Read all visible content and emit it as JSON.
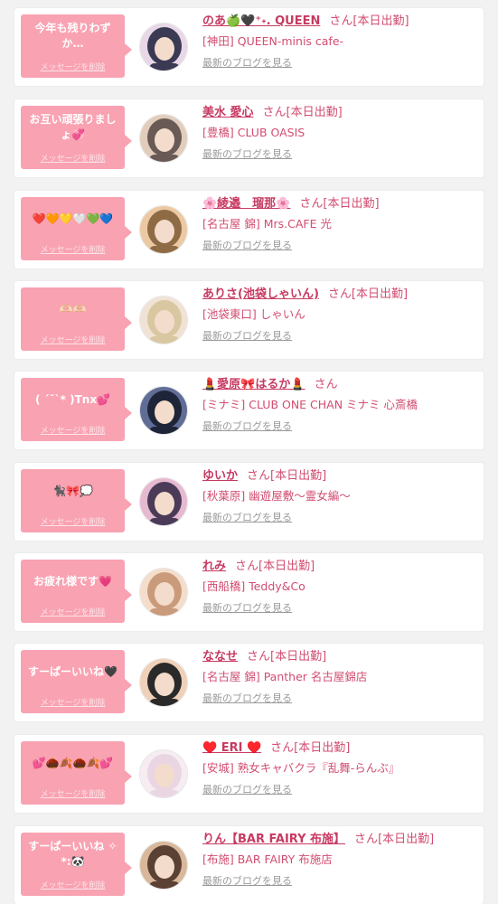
{
  "delete_label": "メッセージを削除",
  "blog_label": "最新のブログを見る",
  "honorific": "さん",
  "colors": {
    "bubble": "#f9a2b2",
    "accent": "#d24d71",
    "background": "#f2f2f2"
  },
  "messages": [
    {
      "bubble": "今年も残りわずか…",
      "name": "のあ🍏🖤⁺˖. QUEEN",
      "status": "[本日出勤]",
      "shop": "[神田] QUEEN-minis cafe-",
      "avatar_colors": [
        "#3a3a55",
        "#e8d7e6"
      ]
    },
    {
      "bubble": "お互い頑張りましょ💞",
      "name": "美水 愛心",
      "status": "[本日出勤]",
      "shop": "[豊橋] CLUB OASIS",
      "avatar_colors": [
        "#6a5a55",
        "#e2cdbd"
      ]
    },
    {
      "bubble": "❤️🧡💛🤍💚💙",
      "name": "🌸綾邉　瑠那🌸",
      "status": "[本日出勤]",
      "shop": "[名古屋 錦] Mrs.CAFE 光",
      "avatar_colors": [
        "#8f6b45",
        "#ecc9a2"
      ]
    },
    {
      "bubble": "🫶🏻🫶🏻",
      "name": "ありさ(池袋しゃいん)",
      "status": "[本日出勤]",
      "shop": "[池袋東口] しゃいん",
      "avatar_colors": [
        "#d8c7a0",
        "#f1e2d6"
      ]
    },
    {
      "bubble": "( ´˘`* )Tnx💕",
      "name": "💄愛原🎀はるか💄",
      "status": "",
      "shop": "[ミナミ] CLUB ONE CHAN ミナミ 心斎橋",
      "avatar_colors": [
        "#1f2538",
        "#606d96"
      ]
    },
    {
      "bubble": "🐈‍⬛🎀💭",
      "name": "ゆいか",
      "status": "[本日出勤]",
      "shop": "[秋葉原] 幽遊屋敷～霊女編～",
      "avatar_colors": [
        "#4b3b58",
        "#e5b9cf"
      ]
    },
    {
      "bubble": "お疲れ様です💗",
      "name": "れみ",
      "status": "[本日出勤]",
      "shop": "[西船橋] Teddy&Co",
      "avatar_colors": [
        "#c99b7b",
        "#f4ddcb"
      ]
    },
    {
      "bubble": "すーぱーいいね🖤",
      "name": "ななせ",
      "status": "[本日出勤]",
      "shop": "[名古屋 錦] Panther 名古屋錦店",
      "avatar_colors": [
        "#2a2a2a",
        "#efd0b8"
      ]
    },
    {
      "bubble": "💕🌰🍂🌰🍂💕",
      "name": "♥️ ERI ♥️",
      "status": "[本日出勤]",
      "shop": "[安城] 熟女キャバクラ『乱舞-らんぶ』",
      "avatar_colors": [
        "#ead6e2",
        "#f6ecf2"
      ]
    },
    {
      "bubble": "すーぱーいいね ✧*:🐼",
      "name": "りん【BAR FAIRY 布施】",
      "status": "[本日出勤]",
      "shop": "[布施] BAR FAIRY 布施店",
      "avatar_colors": [
        "#5b4034",
        "#d9b79a"
      ]
    }
  ]
}
